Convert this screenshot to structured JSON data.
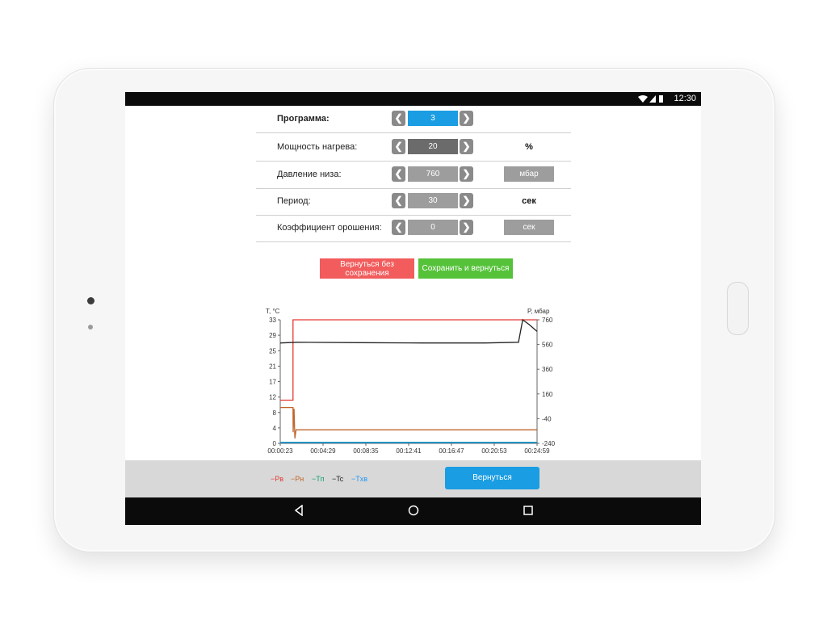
{
  "status": {
    "time": "12:30",
    "icons": [
      "wifi-icon",
      "signal-icon",
      "battery-icon"
    ]
  },
  "params": [
    {
      "label": "Программа:",
      "value": "3",
      "unit": "",
      "unit_style": "none",
      "value_style": "active"
    },
    {
      "label": "Мощность нагрева:",
      "value": "20",
      "unit": "%",
      "unit_style": "text",
      "value_style": "dark"
    },
    {
      "label": "Давление низа:",
      "value": "760",
      "unit": "мбар",
      "unit_style": "box",
      "value_style": "normal"
    },
    {
      "label": "Период:",
      "value": "30",
      "unit": "сек",
      "unit_style": "text",
      "value_style": "normal"
    },
    {
      "label": "Коэффициент орошения:",
      "value": "0",
      "unit": "сек",
      "unit_style": "box",
      "value_style": "normal"
    }
  ],
  "arrows": {
    "left": "❮",
    "right": "❯"
  },
  "buttons": {
    "cancel": "Вернуться без сохранения",
    "save": "Сохранить и вернуться",
    "back": "Вернуться"
  },
  "chart_data": {
    "type": "line",
    "ylabel_left": "T, °C",
    "ylabel_right": "P, мбар",
    "yticks_left": [
      "33",
      "29",
      "25",
      "21",
      "17",
      "12",
      "8",
      "4",
      "0"
    ],
    "yticks_right": [
      "760",
      "560",
      "360",
      "160",
      "-40",
      "-240"
    ],
    "xticks": [
      "00:00:23",
      "00:04:29",
      "00:08:35",
      "00:12:41",
      "00:16:47",
      "00:20:53",
      "00:24:59"
    ],
    "ylim_left": [
      0,
      33
    ],
    "ylim_right": [
      -240,
      760
    ],
    "x_minutes": [
      0.38,
      24.98
    ],
    "grid": false,
    "series": [
      {
        "name": "Pв",
        "color": "#e53935",
        "axis": "right",
        "points": [
          [
            0.38,
            110
          ],
          [
            1.6,
            110
          ],
          [
            1.6,
            760
          ],
          [
            24.98,
            760
          ]
        ]
      },
      {
        "name": "Pн",
        "color": "#c0652a",
        "axis": "right",
        "points": [
          [
            0.38,
            50
          ],
          [
            1.6,
            50
          ],
          [
            1.62,
            -150
          ],
          [
            1.7,
            40
          ],
          [
            1.78,
            -200
          ],
          [
            1.9,
            -130
          ],
          [
            24.98,
            -130
          ]
        ]
      },
      {
        "name": "Tп",
        "color": "#10a070",
        "axis": "left",
        "points": [
          [
            0.38,
            0.3
          ],
          [
            24.98,
            0.3
          ]
        ]
      },
      {
        "name": "Tc",
        "color": "#222222",
        "axis": "left",
        "points": [
          [
            0.38,
            26.8
          ],
          [
            2.0,
            27
          ],
          [
            8,
            26.9
          ],
          [
            14,
            26.8
          ],
          [
            20,
            26.8
          ],
          [
            23.2,
            27
          ],
          [
            23.6,
            33
          ],
          [
            24.2,
            31.8
          ],
          [
            24.98,
            29.9
          ]
        ]
      },
      {
        "name": "Tхв",
        "color": "#2196f3",
        "axis": "left",
        "points": [
          [
            0.38,
            0.2
          ],
          [
            24.98,
            0.2
          ]
        ]
      }
    ]
  },
  "legend": [
    {
      "label": "Pв",
      "color": "#e53935"
    },
    {
      "label": "Pн",
      "color": "#c0652a"
    },
    {
      "label": "Tп",
      "color": "#10a070"
    },
    {
      "label": "Tc",
      "color": "#222222"
    },
    {
      "label": "Tхв",
      "color": "#2196f3"
    }
  ]
}
